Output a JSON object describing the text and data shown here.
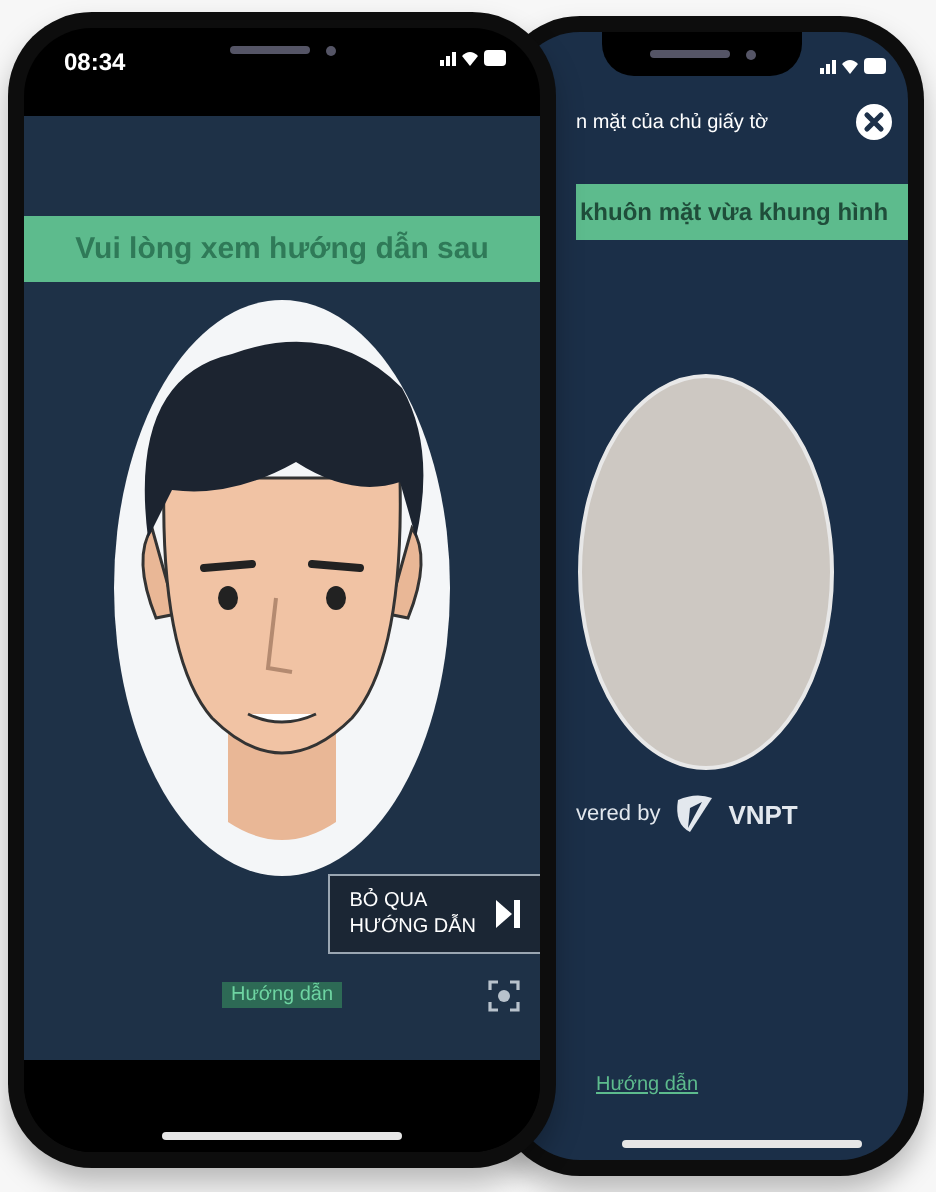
{
  "front_phone": {
    "status_bar": {
      "time": "08:34"
    },
    "banner": "Vui lòng xem hướng dẫn sau",
    "skip_button": [
      "BỎ QUA",
      "HƯỚNG DẪN"
    ],
    "guide_tag": "Hướng dẫn"
  },
  "back_phone": {
    "header": "n mặt của chủ giấy tờ",
    "banner": "khuôn mặt vừa khung hình",
    "powered_by": "vered by",
    "logo": "VNPT",
    "guide_link": "Hướng dẫn"
  }
}
